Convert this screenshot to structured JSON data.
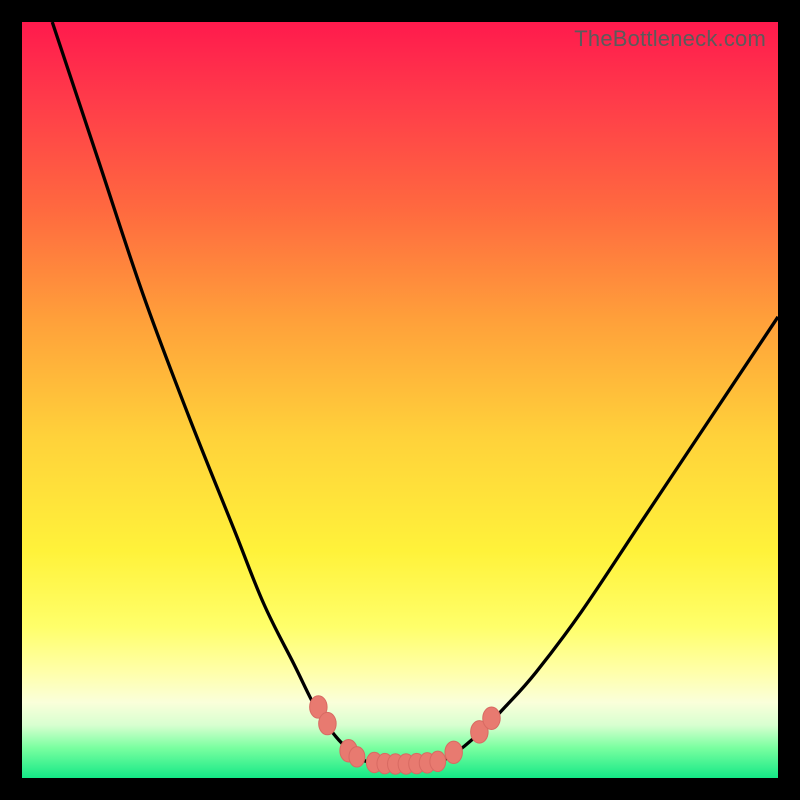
{
  "watermark": "TheBottleneck.com",
  "colors": {
    "top": "#ff1a4d",
    "mid": "#ffe23a",
    "bottom": "#14e886",
    "curve": "#000000",
    "marker": "#e87a70",
    "frame": "#000000"
  },
  "chart_data": {
    "type": "line",
    "title": "",
    "xlabel": "",
    "ylabel": "",
    "xlim": [
      0,
      100
    ],
    "ylim": [
      0,
      100
    ],
    "grid": false,
    "series": [
      {
        "name": "left-curve",
        "x": [
          4,
          10,
          16,
          22,
          28,
          32,
          36,
          39,
          41.5,
          43.5,
          45,
          46.5
        ],
        "y": [
          100,
          82,
          64,
          48,
          33,
          23,
          15,
          9,
          5.5,
          3.5,
          2.4,
          2
        ]
      },
      {
        "name": "right-curve",
        "x": [
          55,
          56.5,
          58.5,
          61,
          64,
          68,
          74,
          82,
          90,
          100
        ],
        "y": [
          2,
          2.8,
          4.2,
          6.4,
          9.5,
          14,
          22,
          34,
          46,
          61
        ]
      },
      {
        "name": "valley-floor",
        "x": [
          46.5,
          49,
          52,
          55
        ],
        "y": [
          2,
          1.8,
          1.8,
          2
        ]
      }
    ],
    "markers": [
      {
        "x": 39.2,
        "y": 9.4,
        "r": 1.1
      },
      {
        "x": 40.4,
        "y": 7.2,
        "r": 1.1
      },
      {
        "x": 43.2,
        "y": 3.6,
        "r": 1.1
      },
      {
        "x": 44.3,
        "y": 2.8,
        "r": 1.0
      },
      {
        "x": 46.6,
        "y": 2.05,
        "r": 1.0
      },
      {
        "x": 48.0,
        "y": 1.9,
        "r": 1.0
      },
      {
        "x": 49.4,
        "y": 1.85,
        "r": 1.0
      },
      {
        "x": 50.8,
        "y": 1.85,
        "r": 1.0
      },
      {
        "x": 52.2,
        "y": 1.9,
        "r": 1.0
      },
      {
        "x": 53.6,
        "y": 2.0,
        "r": 1.0
      },
      {
        "x": 55.0,
        "y": 2.2,
        "r": 1.0
      },
      {
        "x": 57.1,
        "y": 3.4,
        "r": 1.1
      },
      {
        "x": 60.5,
        "y": 6.1,
        "r": 1.1
      },
      {
        "x": 62.1,
        "y": 7.9,
        "r": 1.1
      }
    ]
  }
}
